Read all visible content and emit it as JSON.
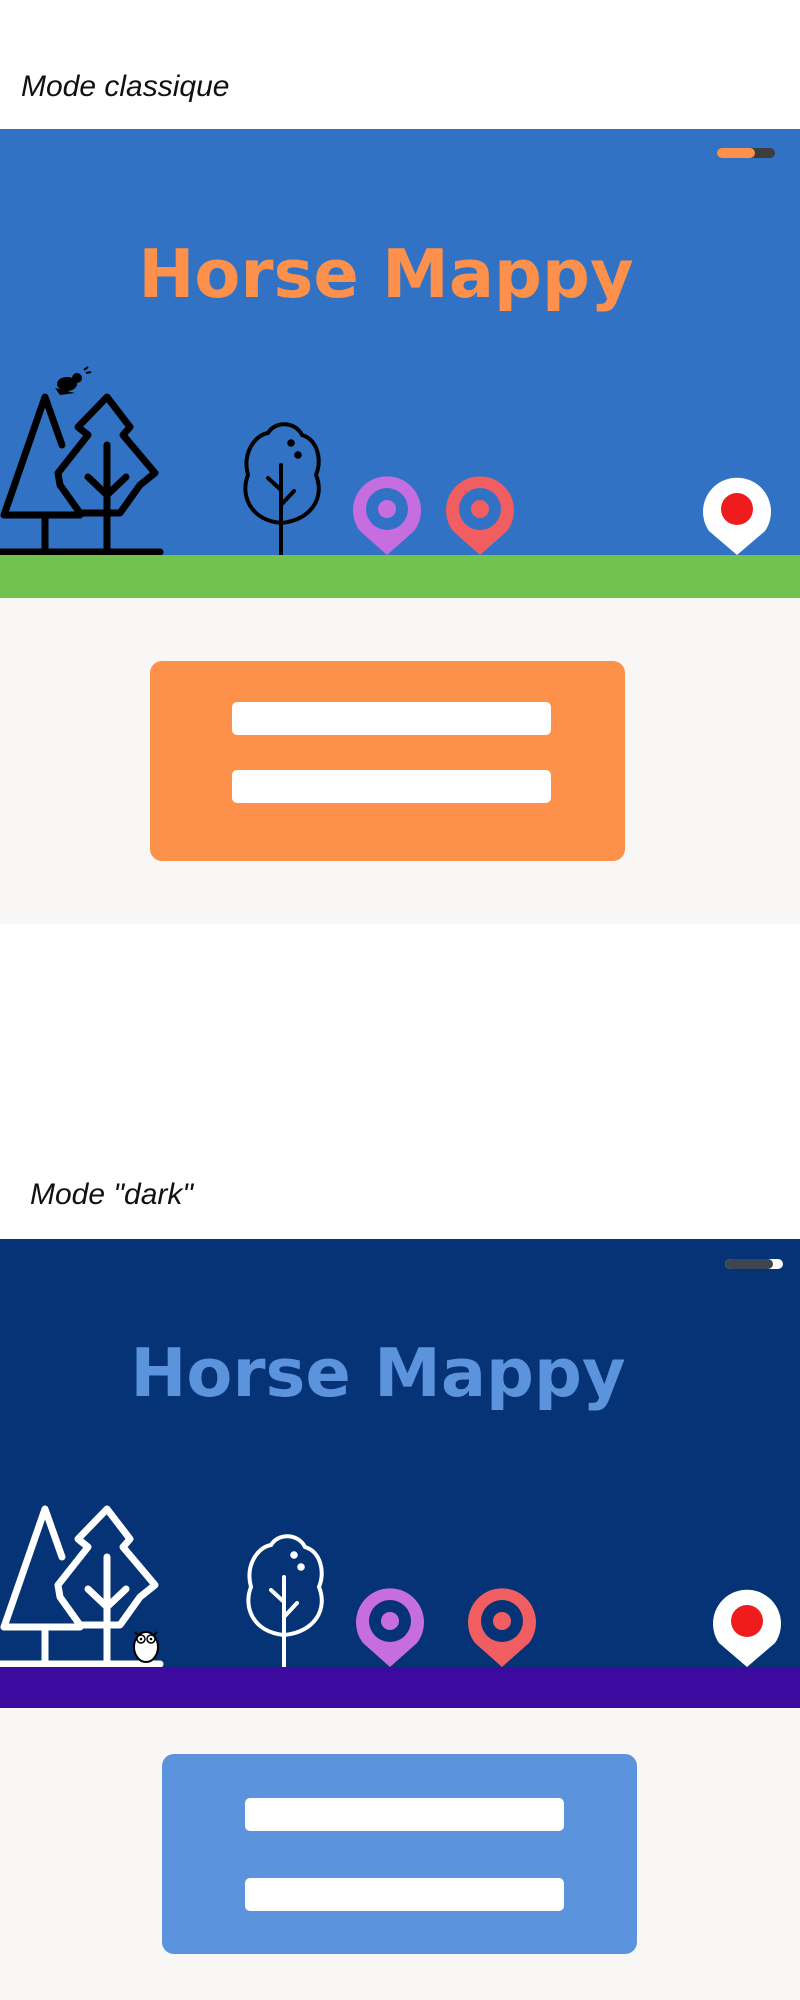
{
  "app": {
    "title": "Horse Mappy"
  },
  "classic": {
    "label": "Mode classique",
    "colors": {
      "sky": "#3172c5",
      "title": "#fd914b",
      "ground": "#71c24f",
      "card": "#fd914b",
      "panel": "#f8f7f6"
    },
    "toggle": {
      "state": "light"
    },
    "pins": [
      {
        "name": "pin-purple",
        "color": "#c66ee0"
      },
      {
        "name": "pin-red",
        "color": "#f05e62"
      },
      {
        "name": "pin-white",
        "color": "#ffffff",
        "dot": "#ee1c1c"
      }
    ],
    "decoration": "bird-icon"
  },
  "dark": {
    "label": "Mode \"dark\"",
    "colors": {
      "sky": "#053375",
      "title": "#5b94dd",
      "ground": "#3d0aa0",
      "card": "#5b94dd",
      "panel": "#f8f7f6"
    },
    "toggle": {
      "state": "dark"
    },
    "pins": [
      {
        "name": "pin-purple",
        "color": "#c66ee0"
      },
      {
        "name": "pin-red",
        "color": "#f05e62"
      },
      {
        "name": "pin-white",
        "color": "#ffffff",
        "dot": "#ee1c1c"
      }
    ],
    "decoration": "owl-icon"
  }
}
